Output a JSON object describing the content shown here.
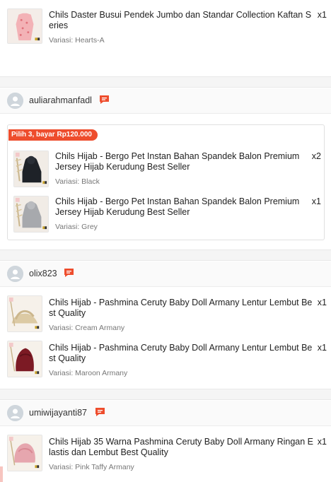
{
  "orders": [
    {
      "shop": null,
      "items": [
        {
          "title": "Chils Daster Busui Pendek Jumbo dan Standar Collection Kaftan Series",
          "qty": "x1",
          "variant": "Variasi: Hearts-A",
          "thumb": "pink-dress"
        }
      ]
    },
    {
      "shop": "auliarahmanfadl",
      "bundle_tag": "Pilih 3, bayar Rp120.000",
      "items": [
        {
          "title": "Chils Hijab - Bergo Pet Instan Bahan Spandek Balon Premium Jersey Hijab Kerudung Best Seller",
          "qty": "x2",
          "variant": "Variasi: Black",
          "thumb": "black-hijab"
        },
        {
          "title": "Chils Hijab - Bergo Pet Instan Bahan Spandek Balon Premium Jersey Hijab Kerudung Best Seller",
          "qty": "x1",
          "variant": "Variasi: Grey",
          "thumb": "grey-hijab"
        }
      ]
    },
    {
      "shop": "olix823",
      "items": [
        {
          "title": "Chils Hijab - Pashmina Ceruty Baby Doll Armany Lentur Lembut Best Quality",
          "qty": "x1",
          "variant": "Variasi: Cream Armany",
          "thumb": "cream-pashmina"
        },
        {
          "title": "Chils Hijab - Pashmina Ceruty Baby Doll Armany Lentur Lembut Best Quality",
          "qty": "x1",
          "variant": "Variasi: Maroon Armany",
          "thumb": "maroon-pashmina"
        }
      ]
    },
    {
      "shop": "umiwijayanti87",
      "items": [
        {
          "title": "Chils Hijab 35 Warna Pashmina Ceruty Baby Doll Armany Ringan Elastis dan Lembut Best Quality",
          "qty": "x1",
          "variant": "Variasi: Pink Taffy Armany",
          "thumb": "pink-pashmina"
        }
      ]
    }
  ],
  "icons": {
    "avatar": "user-avatar-icon",
    "chat": "chat-bubble-icon"
  },
  "colors": {
    "accent": "#ee4d2d",
    "chat_icon": "#ee4d2d",
    "avatar_bg": "#cfd6dc",
    "muted": "#777777"
  }
}
